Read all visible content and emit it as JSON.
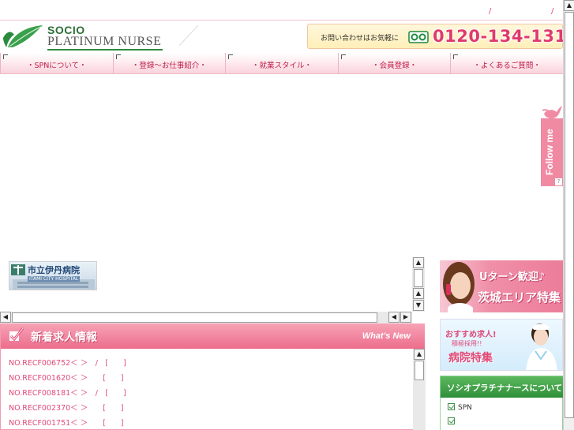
{
  "header": {
    "top_separators": [
      "/",
      "/"
    ],
    "logo": {
      "line1": "SOCIO",
      "line2": "PLATINUM NURSE"
    },
    "contact": {
      "label": "お問い合わせはお気軽に",
      "phone": "0120-134-131"
    }
  },
  "nav": {
    "items": [
      {
        "label": "・SPNについて・"
      },
      {
        "label": "・登録〜お仕事紹介・"
      },
      {
        "label": "・就業スタイル・"
      },
      {
        "label": "・会員登録・"
      },
      {
        "label": "・よくあるご質問・"
      }
    ]
  },
  "follow": {
    "label": "Follow me",
    "help": "?"
  },
  "hospital_banner": {
    "name": "市立伊丹病院",
    "sub": "ITAMI CITY HOSPITAL"
  },
  "whats_new": {
    "title": "新着求人情報",
    "title_en": "What's New",
    "items": [
      "NO.RECF006752＜ ＞　/　[　　]",
      "NO.RECF001620＜ ＞　　[　　]",
      "NO.RECF008181＜ ＞　/　[　　]",
      "NO.RECF002370＜ ＞　　[　　]",
      "NO.RECF001751＜ ＞　　[　　]"
    ]
  },
  "banners": {
    "uturn": {
      "line1": "Uターン歓迎♪",
      "line2": "茨城エリア特集"
    },
    "hospital_feature": {
      "line1": "おすすめ求人!",
      "line2": "積極採用!!",
      "line3": "病院特集"
    }
  },
  "about": {
    "title": "ソシオプラチナナースについて",
    "items": [
      "SPN",
      ""
    ]
  },
  "colors": {
    "accent_pink": "#e0426a",
    "brand_green": "#2c8a3e",
    "header_pink": "#ec6d8c"
  }
}
